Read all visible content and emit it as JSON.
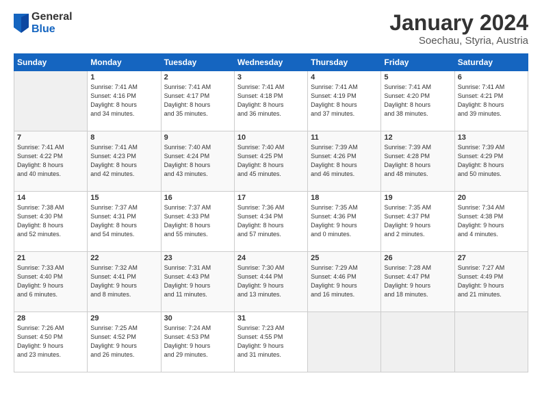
{
  "header": {
    "logo_general": "General",
    "logo_blue": "Blue",
    "month_year": "January 2024",
    "location": "Soechau, Styria, Austria"
  },
  "days_of_week": [
    "Sunday",
    "Monday",
    "Tuesday",
    "Wednesday",
    "Thursday",
    "Friday",
    "Saturday"
  ],
  "weeks": [
    [
      {
        "day": "",
        "content": ""
      },
      {
        "day": "1",
        "content": "Sunrise: 7:41 AM\nSunset: 4:16 PM\nDaylight: 8 hours\nand 34 minutes."
      },
      {
        "day": "2",
        "content": "Sunrise: 7:41 AM\nSunset: 4:17 PM\nDaylight: 8 hours\nand 35 minutes."
      },
      {
        "day": "3",
        "content": "Sunrise: 7:41 AM\nSunset: 4:18 PM\nDaylight: 8 hours\nand 36 minutes."
      },
      {
        "day": "4",
        "content": "Sunrise: 7:41 AM\nSunset: 4:19 PM\nDaylight: 8 hours\nand 37 minutes."
      },
      {
        "day": "5",
        "content": "Sunrise: 7:41 AM\nSunset: 4:20 PM\nDaylight: 8 hours\nand 38 minutes."
      },
      {
        "day": "6",
        "content": "Sunrise: 7:41 AM\nSunset: 4:21 PM\nDaylight: 8 hours\nand 39 minutes."
      }
    ],
    [
      {
        "day": "7",
        "content": "Sunrise: 7:41 AM\nSunset: 4:22 PM\nDaylight: 8 hours\nand 40 minutes."
      },
      {
        "day": "8",
        "content": "Sunrise: 7:41 AM\nSunset: 4:23 PM\nDaylight: 8 hours\nand 42 minutes."
      },
      {
        "day": "9",
        "content": "Sunrise: 7:40 AM\nSunset: 4:24 PM\nDaylight: 8 hours\nand 43 minutes."
      },
      {
        "day": "10",
        "content": "Sunrise: 7:40 AM\nSunset: 4:25 PM\nDaylight: 8 hours\nand 45 minutes."
      },
      {
        "day": "11",
        "content": "Sunrise: 7:39 AM\nSunset: 4:26 PM\nDaylight: 8 hours\nand 46 minutes."
      },
      {
        "day": "12",
        "content": "Sunrise: 7:39 AM\nSunset: 4:28 PM\nDaylight: 8 hours\nand 48 minutes."
      },
      {
        "day": "13",
        "content": "Sunrise: 7:39 AM\nSunset: 4:29 PM\nDaylight: 8 hours\nand 50 minutes."
      }
    ],
    [
      {
        "day": "14",
        "content": "Sunrise: 7:38 AM\nSunset: 4:30 PM\nDaylight: 8 hours\nand 52 minutes."
      },
      {
        "day": "15",
        "content": "Sunrise: 7:37 AM\nSunset: 4:31 PM\nDaylight: 8 hours\nand 54 minutes."
      },
      {
        "day": "16",
        "content": "Sunrise: 7:37 AM\nSunset: 4:33 PM\nDaylight: 8 hours\nand 55 minutes."
      },
      {
        "day": "17",
        "content": "Sunrise: 7:36 AM\nSunset: 4:34 PM\nDaylight: 8 hours\nand 57 minutes."
      },
      {
        "day": "18",
        "content": "Sunrise: 7:35 AM\nSunset: 4:36 PM\nDaylight: 9 hours\nand 0 minutes."
      },
      {
        "day": "19",
        "content": "Sunrise: 7:35 AM\nSunset: 4:37 PM\nDaylight: 9 hours\nand 2 minutes."
      },
      {
        "day": "20",
        "content": "Sunrise: 7:34 AM\nSunset: 4:38 PM\nDaylight: 9 hours\nand 4 minutes."
      }
    ],
    [
      {
        "day": "21",
        "content": "Sunrise: 7:33 AM\nSunset: 4:40 PM\nDaylight: 9 hours\nand 6 minutes."
      },
      {
        "day": "22",
        "content": "Sunrise: 7:32 AM\nSunset: 4:41 PM\nDaylight: 9 hours\nand 8 minutes."
      },
      {
        "day": "23",
        "content": "Sunrise: 7:31 AM\nSunset: 4:43 PM\nDaylight: 9 hours\nand 11 minutes."
      },
      {
        "day": "24",
        "content": "Sunrise: 7:30 AM\nSunset: 4:44 PM\nDaylight: 9 hours\nand 13 minutes."
      },
      {
        "day": "25",
        "content": "Sunrise: 7:29 AM\nSunset: 4:46 PM\nDaylight: 9 hours\nand 16 minutes."
      },
      {
        "day": "26",
        "content": "Sunrise: 7:28 AM\nSunset: 4:47 PM\nDaylight: 9 hours\nand 18 minutes."
      },
      {
        "day": "27",
        "content": "Sunrise: 7:27 AM\nSunset: 4:49 PM\nDaylight: 9 hours\nand 21 minutes."
      }
    ],
    [
      {
        "day": "28",
        "content": "Sunrise: 7:26 AM\nSunset: 4:50 PM\nDaylight: 9 hours\nand 23 minutes."
      },
      {
        "day": "29",
        "content": "Sunrise: 7:25 AM\nSunset: 4:52 PM\nDaylight: 9 hours\nand 26 minutes."
      },
      {
        "day": "30",
        "content": "Sunrise: 7:24 AM\nSunset: 4:53 PM\nDaylight: 9 hours\nand 29 minutes."
      },
      {
        "day": "31",
        "content": "Sunrise: 7:23 AM\nSunset: 4:55 PM\nDaylight: 9 hours\nand 31 minutes."
      },
      {
        "day": "",
        "content": ""
      },
      {
        "day": "",
        "content": ""
      },
      {
        "day": "",
        "content": ""
      }
    ]
  ]
}
